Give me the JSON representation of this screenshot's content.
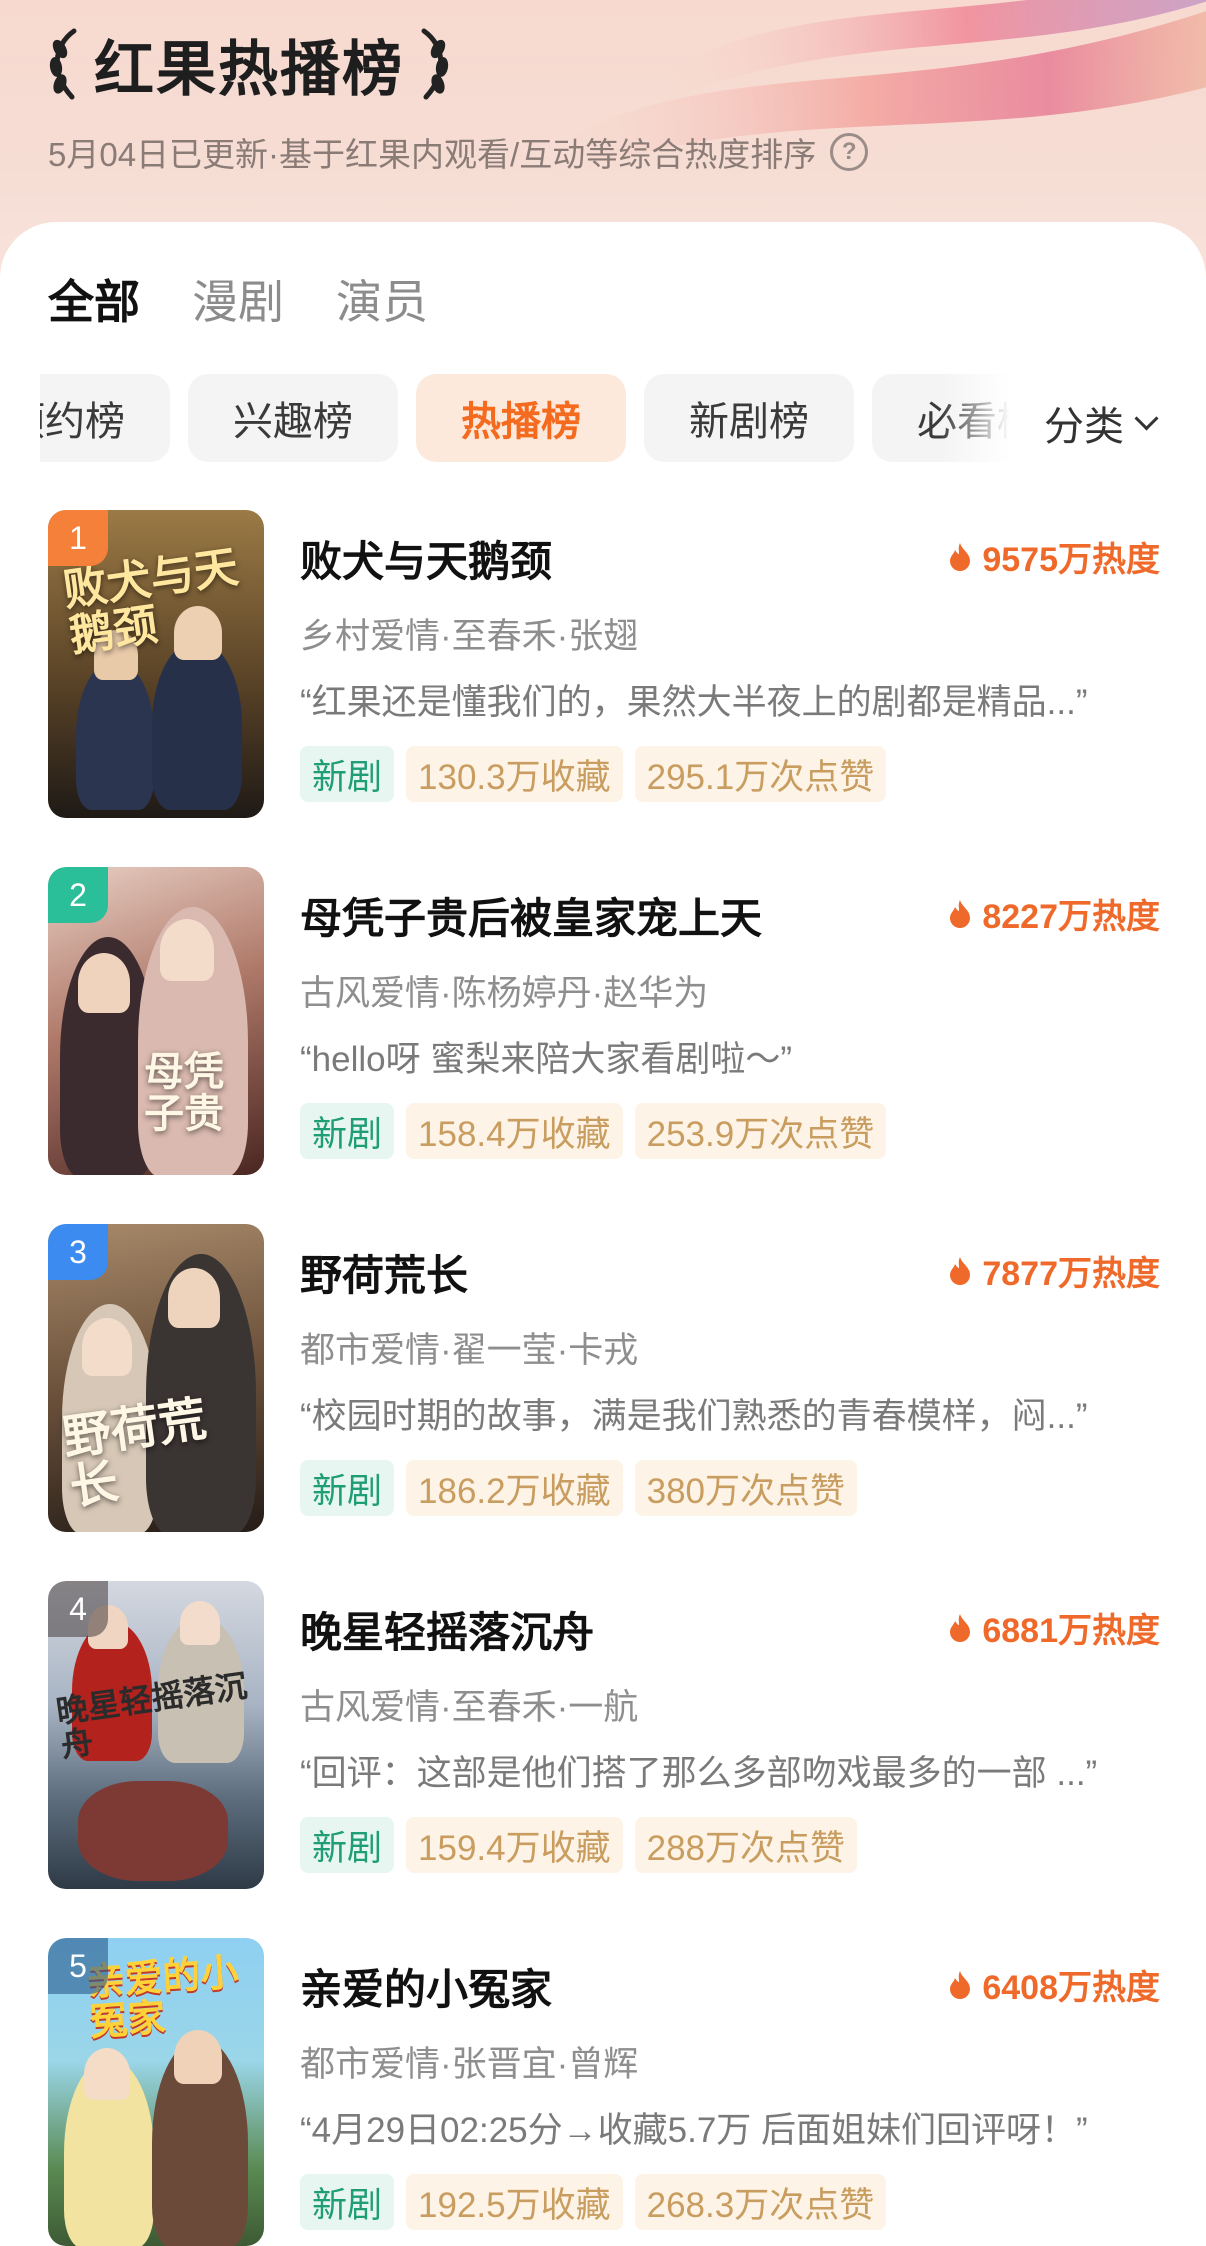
{
  "header": {
    "title": "红果热播榜",
    "subtitle": "5月04日已更新·基于红果内观看/互动等综合热度排序",
    "help_icon": "help-circle-icon"
  },
  "tabs": [
    {
      "label": "全部",
      "active": true
    },
    {
      "label": "漫剧",
      "active": false
    },
    {
      "label": "演员",
      "active": false
    }
  ],
  "chips": [
    {
      "label": "预约榜",
      "active": false
    },
    {
      "label": "兴趣榜",
      "active": false
    },
    {
      "label": "热播榜",
      "active": true
    },
    {
      "label": "新剧榜",
      "active": false
    },
    {
      "label": "必看榜",
      "active": false
    }
  ],
  "category": {
    "label": "分类",
    "icon": "chevron-down-icon"
  },
  "colors": {
    "accent": "#f46b1f",
    "heat": "#ef6a2a",
    "new_tag": "#1f9d74",
    "stat_tag": "#c89d5f"
  },
  "list": [
    {
      "rank": "1",
      "rank_color": "#f5803a",
      "poster_text": "败犬与天鹅颈",
      "poster_colors": [
        "#8a6a3f",
        "#2c2418"
      ],
      "name": "败犬与天鹅颈",
      "heat": "9575万热度",
      "meta": "乡村爱情·至春禾·张翅",
      "quote": "“红果还是懂我们的，果然大半夜上的剧都是精品...”",
      "tag_new": "新剧",
      "favorites": "130.3万收藏",
      "likes": "295.1万次点赞"
    },
    {
      "rank": "2",
      "rank_color": "#2bbf99",
      "poster_text": "母凭子贵",
      "poster_colors": [
        "#c99a88",
        "#5a2e28"
      ],
      "name": "母凭子贵后被皇家宠上天",
      "heat": "8227万热度",
      "meta": "古风爱情·陈杨婷丹·赵华为",
      "quote": "“hello呀 蜜梨来陪大家看剧啦～”",
      "tag_new": "新剧",
      "favorites": "158.4万收藏",
      "likes": "253.9万次点赞"
    },
    {
      "rank": "3",
      "rank_color": "#3b8bf0",
      "poster_text": "野荷荒长",
      "poster_colors": [
        "#8f6b4a",
        "#2a1f18"
      ],
      "name": "野荷荒长",
      "heat": "7877万热度",
      "meta": "都市爱情·翟一莹·卡戎",
      "quote": "“校园时期的故事，满是我们熟悉的青春模样，闷...”",
      "tag_new": "新剧",
      "favorites": "186.2万收藏",
      "likes": "380万次点赞"
    },
    {
      "rank": "4",
      "rank_color": "rgba(70,60,60,0.55)",
      "poster_text": "晚星轻摇落沉舟",
      "poster_colors": [
        "#c7cbd6",
        "#8a2a25"
      ],
      "name": "晚星轻摇落沉舟",
      "heat": "6881万热度",
      "meta": "古风爱情·至春禾·一航",
      "quote": "“回评：这部是他们搭了那么多部吻戏最多的一部 ...”",
      "tag_new": "新剧",
      "favorites": "159.4万收藏",
      "likes": "288万次点赞"
    },
    {
      "rank": "5",
      "rank_color": "rgba(40,90,140,0.6)",
      "poster_text": "亲爱的小冤家",
      "poster_colors": [
        "#7fc2e8",
        "#d9a640"
      ],
      "name": "亲爱的小冤家",
      "heat": "6408万热度",
      "meta": "都市爱情·张晋宜·曾辉",
      "quote": "“4月29日02:25分→收藏5.7万 后面姐妹们回评呀！”",
      "tag_new": "新剧",
      "favorites": "192.5万收藏",
      "likes": "268.3万次点赞"
    }
  ]
}
